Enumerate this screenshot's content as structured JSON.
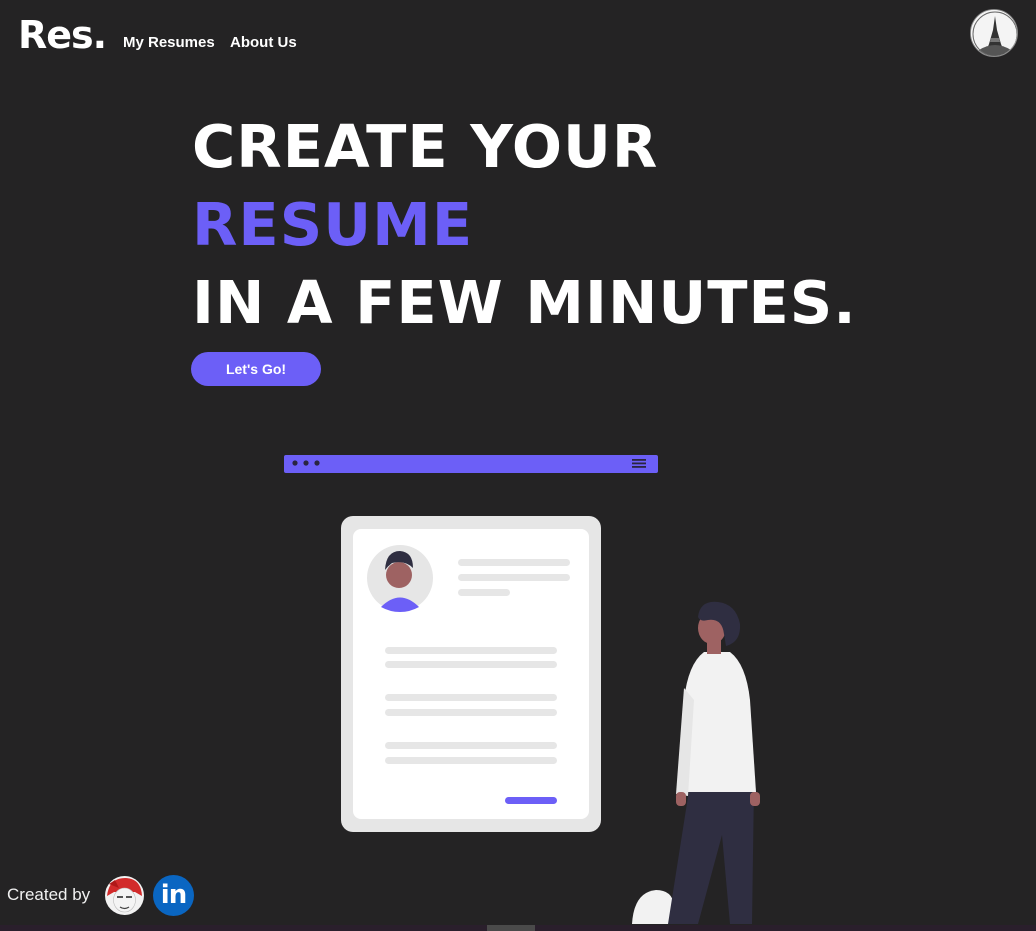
{
  "nav": {
    "logo": "Res.",
    "links": [
      {
        "label": "My Resumes"
      },
      {
        "label": "About Us"
      }
    ]
  },
  "hero": {
    "line1": "CREATE YOUR",
    "line2": "RESUME",
    "line3": "IN A FEW MINUTES.",
    "cta_label": "Let's Go!"
  },
  "footer": {
    "created_by": "Created by",
    "linkedin_label": "in"
  },
  "colors": {
    "background": "#242324",
    "accent": "#6c5ff7",
    "text": "#ffffff",
    "linkedin": "#0a66c2"
  },
  "icons": {
    "profile": "profile-avatar-icon",
    "creator": "creator-avatar-icon",
    "linkedin": "linkedin-icon"
  }
}
